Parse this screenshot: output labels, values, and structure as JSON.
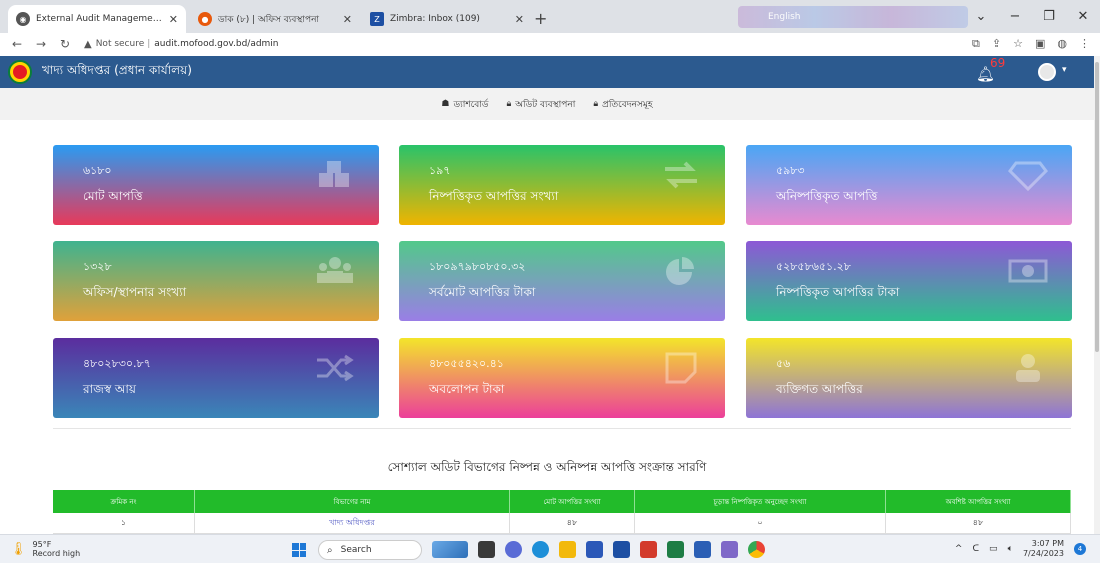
{
  "browser": {
    "tabs": [
      {
        "label": "External Audit Management Syst",
        "active": true,
        "color": "#555555"
      },
      {
        "label": "ডাক (৮) | অফিস ব্যবস্থাপনা",
        "active": false,
        "color": "#e8590c"
      },
      {
        "label": "Zimbra: Inbox (109)",
        "active": false,
        "color": "#1d4fa3"
      }
    ],
    "mid_tab_label": "English",
    "url_prefix": "Not secure",
    "url": "audit.mofood.gov.bd/admin"
  },
  "header": {
    "title": "খাদ্য অধিদপ্তর (প্রধান কার্যালয়)",
    "notification_count": "69"
  },
  "subnav": {
    "items": [
      {
        "label": "ড্যাশবোর্ড"
      },
      {
        "label": "অডিট ব্যবস্থাপনা"
      },
      {
        "label": "প্রতিবেদনসমূহ"
      }
    ]
  },
  "cards": [
    {
      "value": "৬১৮০",
      "label": "মোট আপত্তি",
      "icon": "cubes-icon",
      "gradient": [
        "#2a9bf2",
        "#e8395a"
      ]
    },
    {
      "value": "১৯৭",
      "label": "নিষ্পত্তিকৃত আপত্তির সংখ্যা",
      "icon": "exchange-icon",
      "gradient": [
        "#29c36a",
        "#f0b400"
      ]
    },
    {
      "value": "৫৯৮৩",
      "label": "অনিষ্পত্তিকৃত আপত্তি",
      "icon": "diamond-icon",
      "gradient": [
        "#4aa6f5",
        "#e88ad0"
      ]
    },
    {
      "value": "১৩২৮",
      "label": "অফিস/স্থাপনার সংখ্যা",
      "icon": "users-icon",
      "gradient": [
        "#3fb38f",
        "#e0a13a"
      ]
    },
    {
      "value": "১৮০৯৭৯৮০৮৫০.৩২",
      "label": "সর্বমোট আপত্তির টাকা",
      "icon": "pie-chart-icon",
      "gradient": [
        "#52c98a",
        "#9a7ee6"
      ]
    },
    {
      "value": "৫২৮৫৮৬৫১.২৮",
      "label": "নিষ্পত্তিকৃত আপত্তির টাকা",
      "icon": "money-icon",
      "gradient": [
        "#8d58d6",
        "#2fbf8e"
      ]
    },
    {
      "value": "৪৮০২৮৩০.৮৭",
      "label": "রাজস্ব আয়",
      "icon": "random-icon",
      "gradient": [
        "#5b2d9e",
        "#3a86b8"
      ]
    },
    {
      "value": "৪৮০৫৫৪২০.৪১",
      "label": "অবলোপন টাকা",
      "icon": "sticky-note-icon",
      "gradient": [
        "#f3e52a",
        "#ec3f9a"
      ]
    },
    {
      "value": "৫৬",
      "label": "ব্যক্তিগত আপত্তির",
      "icon": "user-icon",
      "gradient": [
        "#f3e52a",
        "#8e74d6"
      ]
    }
  ],
  "table": {
    "title": "সোশ্যাল অডিট বিভাগের নিষ্পন্ন ও অনিষ্পন্ন আপত্তি সংক্রান্ত সারণি",
    "columns": [
      "ক্রমিক নং",
      "বিভাগের নাম",
      "মোট আপত্তির সংখ্যা",
      "চূড়ান্ত নিষ্পত্তিকৃত অনুচ্ছেদ সংখ্যা",
      "অবশিষ্ট আপত্তির সংখ্যা"
    ],
    "rows": [
      [
        "১",
        "খাদ্য অধিদপ্তর",
        "৪৮",
        "০",
        "৪৮"
      ]
    ]
  },
  "taskbar": {
    "temperature": "95°F",
    "weather_note": "Record high",
    "search_placeholder": "Search",
    "time": "3:07 PM",
    "date": "7/24/2023",
    "notification_badge": "4"
  }
}
